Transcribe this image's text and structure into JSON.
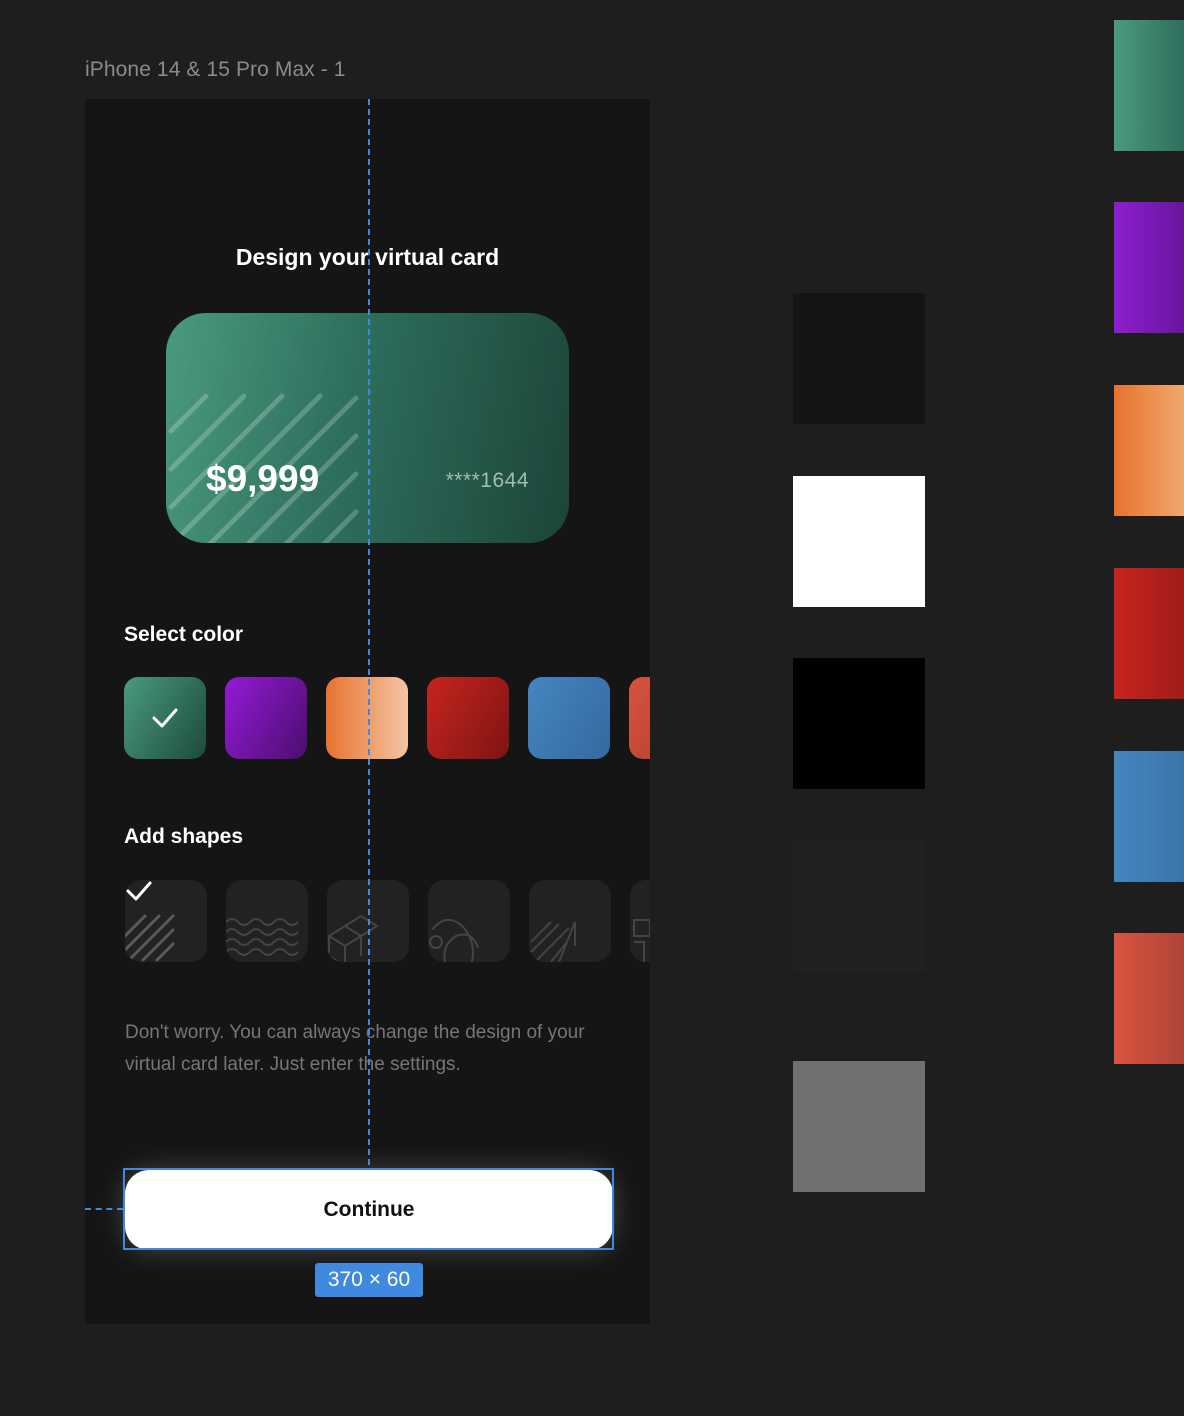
{
  "frame": {
    "label": "iPhone 14 & 15 Pro Max - 1"
  },
  "screen": {
    "title": "Design your virtual card",
    "card": {
      "amount": "$9,999",
      "number": "****1644"
    },
    "select_color_label": "Select color",
    "add_shapes_label": "Add shapes",
    "helper_text": "Don't worry. You can always change the design of your virtual card later. Just enter the settings.",
    "continue_label": "Continue"
  },
  "selection": {
    "dimensions": "370 × 60"
  },
  "colors": {
    "green": "#4a9a80",
    "purple": "#8b1fd0",
    "orange": "#e8722e",
    "red": "#c0221f",
    "blue": "#3e7cb4",
    "coral": "#d0503a",
    "background": "#151515",
    "white": "#ffffff",
    "black": "#000000",
    "gray": "#707070",
    "accent": "#3f8ae0"
  }
}
